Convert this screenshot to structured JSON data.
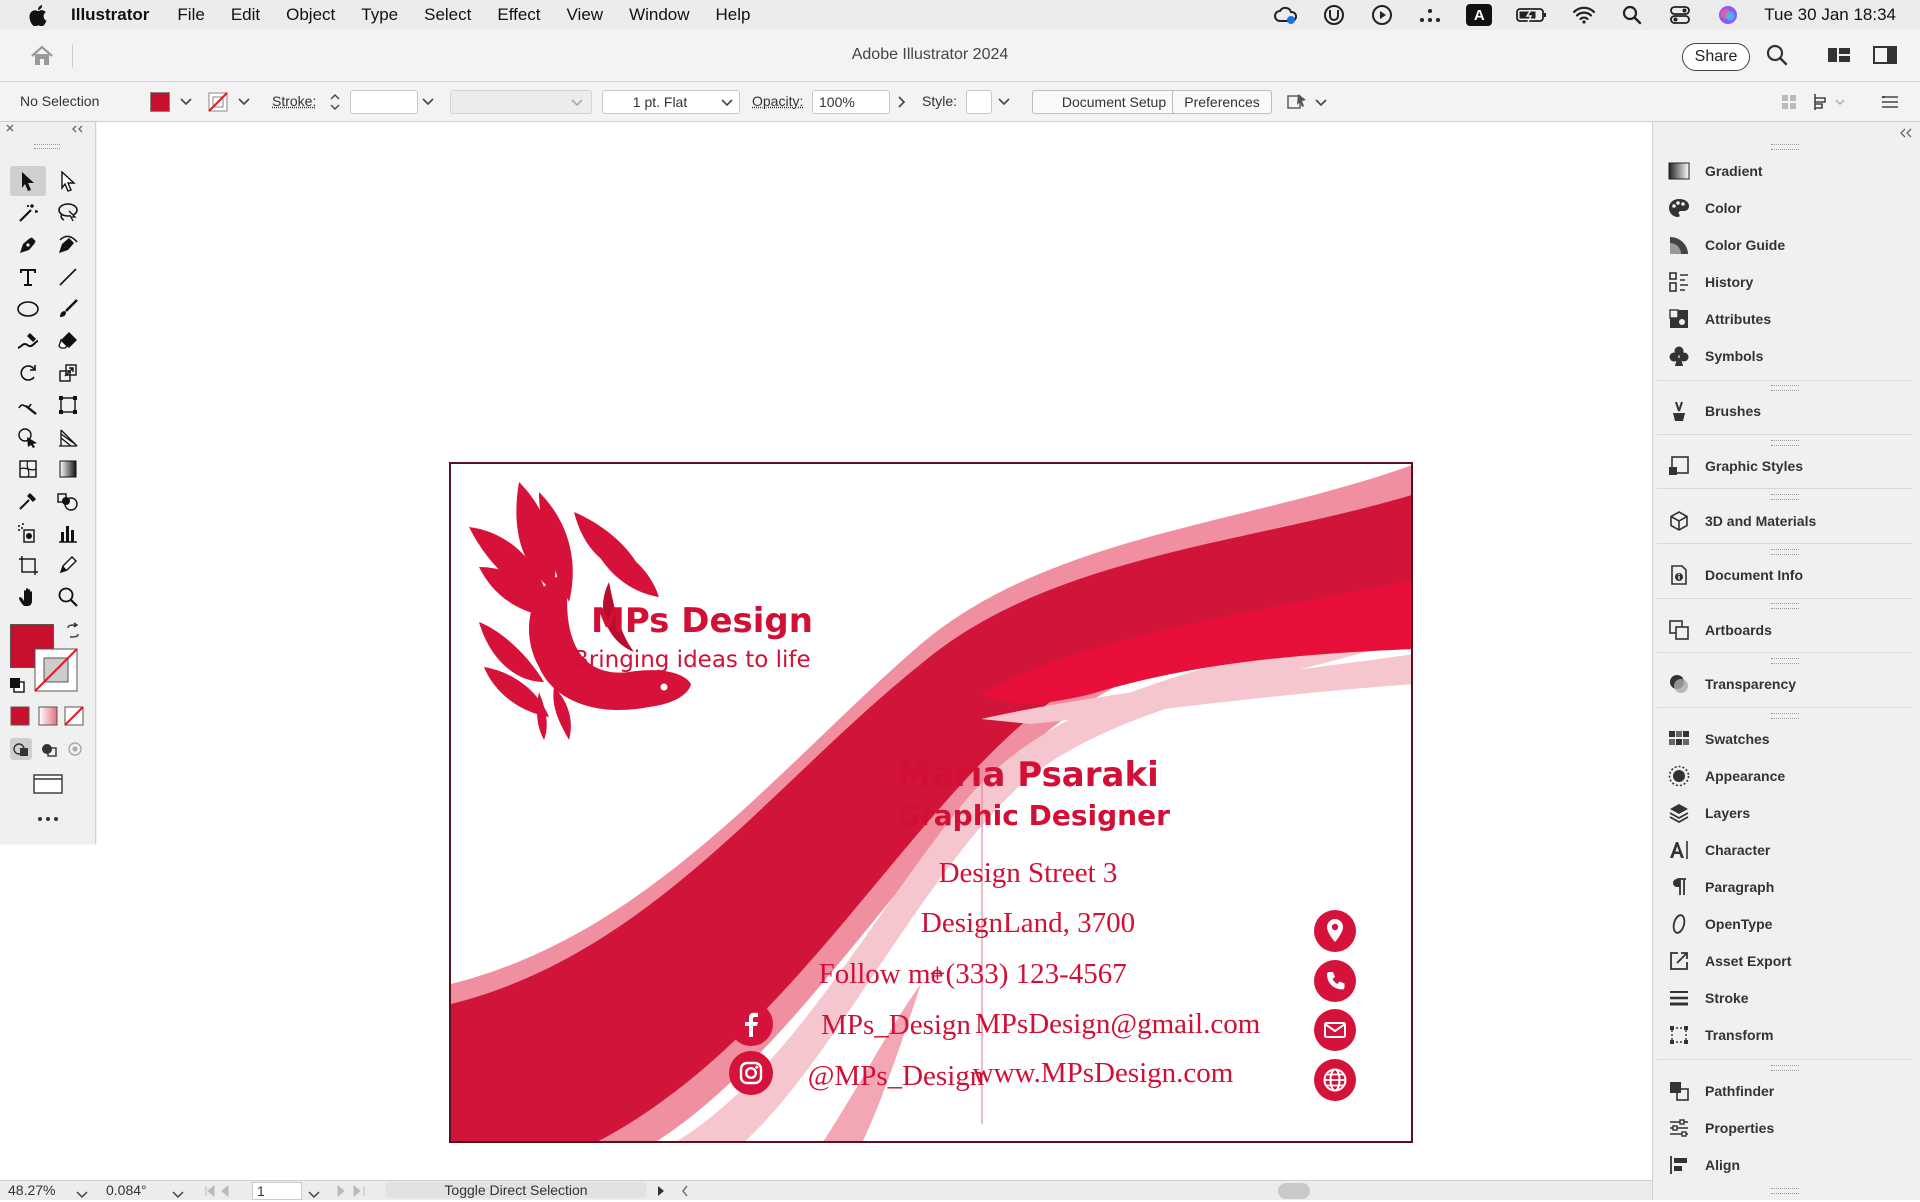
{
  "menubar": {
    "app_name": "Illustrator",
    "items": [
      "File",
      "Edit",
      "Object",
      "Type",
      "Select",
      "Effect",
      "View",
      "Window",
      "Help"
    ],
    "status_icons": [
      "creative-cloud-icon",
      "torrent-icon",
      "play-icon",
      "dots-icon",
      "input-a-icon",
      "battery-icon",
      "wifi-icon",
      "search-icon",
      "control-center-icon",
      "siri-icon"
    ],
    "input_letter": "A",
    "clock": "Tue 30 Jan  18:34"
  },
  "titlebar": {
    "title": "Adobe Illustrator 2024",
    "share_label": "Share"
  },
  "controlbar": {
    "selection_label": "No Selection",
    "stroke_label": "Stroke:",
    "stroke_value": "",
    "stroke_profile": "1 pt. Flat",
    "opacity_label": "Opacity:",
    "opacity_value": "100%",
    "style_label": "Style:",
    "document_setup": "Document Setup",
    "preferences": "Preferences"
  },
  "colors": {
    "accent": "#d20f35",
    "fill": "#c8102e",
    "dark_border": "#5c0f1e",
    "ribbon_light": "#f6c6cf",
    "ribbon_mid": "#ef8fa0"
  },
  "card": {
    "brand_name": "MPs Design",
    "tagline": "Bringing ideas to life",
    "person_name": "Maria Psaraki",
    "person_title": "Graphic Designer",
    "address_line1": "Design Street 3",
    "address_line2": "DesignLand, 3700",
    "phone": "+(333) 123-4567",
    "email": "MPsDesign@gmail.com",
    "website": "www.MPsDesign.com",
    "follow_label": "Follow me",
    "facebook_handle": "MPs_Design",
    "instagram_handle": "@MPs_Design"
  },
  "panels": {
    "group1": [
      "Gradient",
      "Color",
      "Color Guide",
      "History",
      "Attributes",
      "Symbols"
    ],
    "group2": [
      "Brushes"
    ],
    "group3": [
      "Graphic Styles"
    ],
    "group4": [
      "3D and Materials"
    ],
    "group5": [
      "Document Info"
    ],
    "group6": [
      "Artboards"
    ],
    "group7": [
      "Transparency"
    ],
    "group8": [
      "Swatches",
      "Appearance",
      "Layers",
      "Character",
      "Paragraph",
      "OpenType",
      "Asset Export",
      "Stroke",
      "Transform"
    ],
    "group9": [
      "Pathfinder",
      "Properties",
      "Align"
    ]
  },
  "statusbar": {
    "zoom": "48.27%",
    "rotation": "0.084°",
    "artboard_number": "1",
    "status_text": "Toggle Direct Selection"
  }
}
